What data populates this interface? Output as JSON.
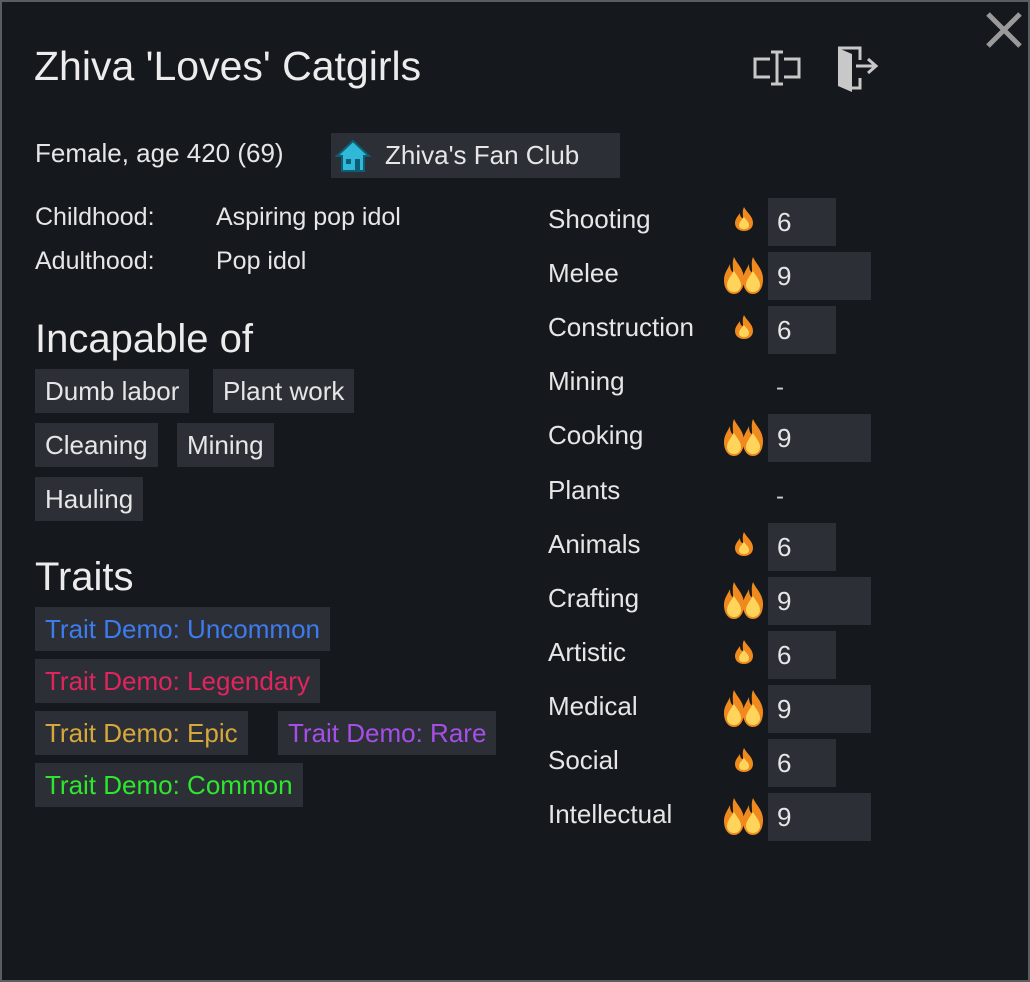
{
  "pawn": {
    "name": "Zhiva 'Loves' Catgirls",
    "info": "Female, age 420 (69)",
    "faction": "Zhiva's Fan Club"
  },
  "backstory": {
    "childhood_label": "Childhood:",
    "childhood": "Aspiring pop idol",
    "adulthood_label": "Adulthood:",
    "adulthood": "Pop idol"
  },
  "incapable": {
    "heading": "Incapable of",
    "items": [
      "Dumb labor",
      "Plant work",
      "Cleaning",
      "Mining",
      "Hauling"
    ]
  },
  "traits": {
    "heading": "Traits",
    "items": [
      {
        "label": "Trait Demo: Uncommon",
        "color": "#3d7bef"
      },
      {
        "label": "Trait Demo: Legendary",
        "color": "#e0245e"
      },
      {
        "label": "Trait Demo: Epic",
        "color": "#d6a83c"
      },
      {
        "label": "Trait Demo: Rare",
        "color": "#a64ee8"
      },
      {
        "label": "Trait Demo: Common",
        "color": "#2ee62e"
      }
    ]
  },
  "skills": [
    {
      "name": "Shooting",
      "level": "6",
      "passion": "minor"
    },
    {
      "name": "Melee",
      "level": "9",
      "passion": "major"
    },
    {
      "name": "Construction",
      "level": "6",
      "passion": "minor"
    },
    {
      "name": "Mining",
      "level": "-",
      "passion": "none"
    },
    {
      "name": "Cooking",
      "level": "9",
      "passion": "major"
    },
    {
      "name": "Plants",
      "level": "-",
      "passion": "none"
    },
    {
      "name": "Animals",
      "level": "6",
      "passion": "minor"
    },
    {
      "name": "Crafting",
      "level": "9",
      "passion": "major"
    },
    {
      "name": "Artistic",
      "level": "6",
      "passion": "minor"
    },
    {
      "name": "Medical",
      "level": "9",
      "passion": "major"
    },
    {
      "name": "Social",
      "level": "6",
      "passion": "minor"
    },
    {
      "name": "Intellectual",
      "level": "9",
      "passion": "major"
    }
  ],
  "icons": {
    "close": "close-icon",
    "rename": "rename-icon",
    "banish": "banish-icon",
    "faction": "house-icon",
    "passion_minor": "flame-icon",
    "passion_major": "double-flame-icon"
  }
}
